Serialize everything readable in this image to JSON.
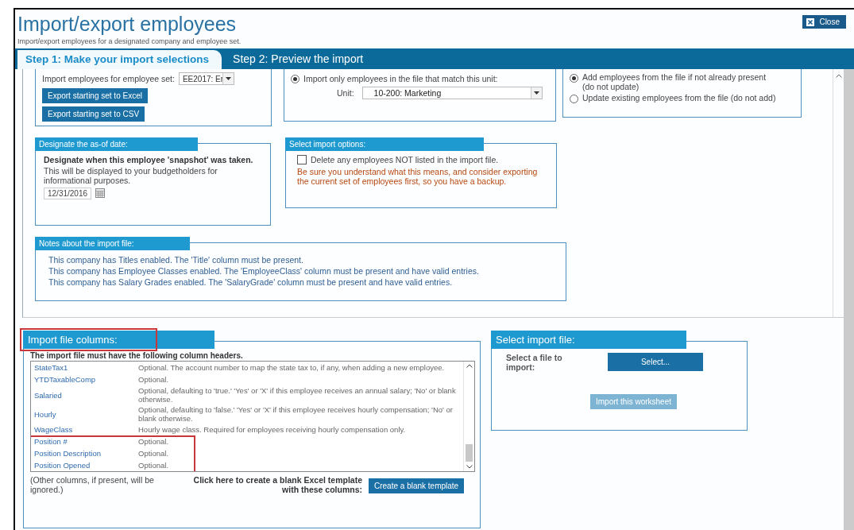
{
  "header": {
    "title": "Import/export employees",
    "subtitle": "Import/export employees for a designated company and employee set.",
    "close_label": "Close"
  },
  "tabs": [
    {
      "label": "Step 1: Make your import selections",
      "selected": true
    },
    {
      "label": "Step 2: Preview the import",
      "selected": false
    }
  ],
  "employee_set": {
    "label": "Import employees for employee set:",
    "value": "EE2017: Er",
    "buttons": [
      "Export starting set to Excel",
      "Export starting set to CSV"
    ]
  },
  "unit_filter": {
    "options": [
      {
        "label": "Import only employees in the file that match this unit:",
        "selected": true
      }
    ],
    "unit_label": "Unit:",
    "unit_value": "10-200: Marketing"
  },
  "import_mode": {
    "options": [
      {
        "label": "Add employees from the file if not already present",
        "note": "(do not update)",
        "selected": true
      },
      {
        "label": "Update existing employees from the file (do not add)",
        "selected": false
      }
    ]
  },
  "as_of_date": {
    "heading": "Designate the as-of date:",
    "lead": "Designate when this employee 'snapshot' was taken.",
    "description": "This will be displayed to your budgetholders for informational purposes.",
    "date": "12/31/2016"
  },
  "import_options": {
    "heading": "Select import options:",
    "checkbox": {
      "label": "Delete any employees NOT listed in the import file.",
      "checked": false
    },
    "warning": "Be sure you understand what this means, and consider exporting the current set of employees first, so you have a backup."
  },
  "notes": {
    "heading": "Notes about the import file:",
    "lines": [
      "This company has Titles enabled.  The 'Title' column must be present.",
      "This company has Employee Classes enabled.  The 'EmployeeClass' column must be present and have valid entries.",
      "This company has Salary Grades enabled.  The 'SalaryGrade' column must be present and have valid entries."
    ]
  },
  "columns": {
    "heading": "Import file columns:",
    "highlighted": true,
    "intro": "The import file must have the following column headers.",
    "rows": [
      {
        "name": "StateTax1",
        "description": "Optional. The account number to map the state tax to, if any, when adding a new employee.",
        "highlighted": false
      },
      {
        "name": "YTDTaxableComp",
        "description": "Optional.",
        "highlighted": false
      },
      {
        "name": "Salaried",
        "description": "Optional, defaulting to 'true.' 'Yes' or 'X' if this employee receives an annual salary; 'No' or blank otherwise.",
        "highlighted": false
      },
      {
        "name": "Hourly",
        "description": "Optional, defaulting to 'false.' 'Yes' or 'X' if this employee receives hourly compensation; 'No' or blank otherwise.",
        "highlighted": false
      },
      {
        "name": "WageClass",
        "description": "Hourly wage class. Required for employees receiving hourly compensation only.",
        "highlighted": false
      },
      {
        "name": "Position #",
        "description": "Optional.",
        "highlighted": true
      },
      {
        "name": "Position Description",
        "description": "Optional.",
        "highlighted": true
      },
      {
        "name": "Position Opened",
        "description": "Optional.",
        "highlighted": true
      }
    ],
    "footer_note": "(Other columns, if present, will be ignored.)",
    "template_prompt": "Click here to create a blank Excel template with these columns:",
    "template_button": "Create a blank template"
  },
  "file_select": {
    "heading": "Select import file:",
    "prompt": "Select a file to import:",
    "select_button": "Select...",
    "import_button": "Import this worksheet",
    "import_disabled": true
  }
}
